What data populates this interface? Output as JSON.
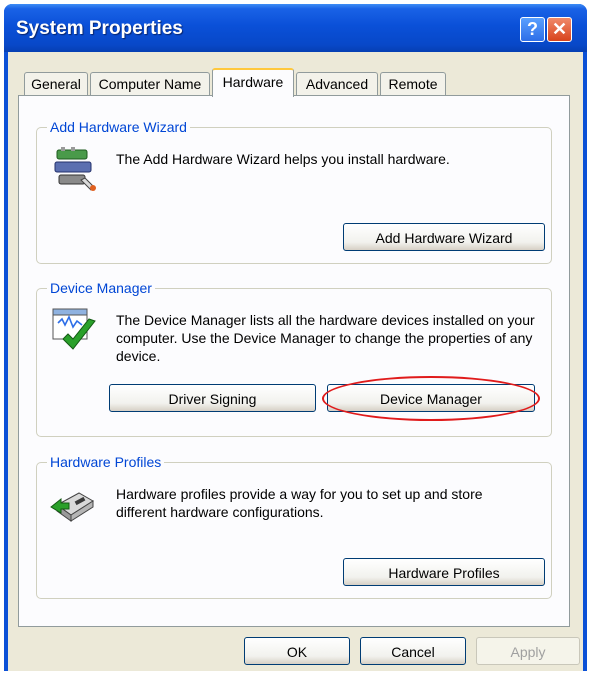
{
  "window": {
    "title": "System Properties",
    "help_glyph": "?",
    "close_glyph": "✕"
  },
  "tabs": [
    {
      "label": "General"
    },
    {
      "label": "Computer Name"
    },
    {
      "label": "Hardware",
      "active": true
    },
    {
      "label": "Advanced"
    },
    {
      "label": "Remote"
    }
  ],
  "add_hardware": {
    "group_title": "Add Hardware Wizard",
    "description": "The Add Hardware Wizard helps you install hardware.",
    "button_label": "Add Hardware Wizard",
    "icon": "add-hardware-wizard-icon"
  },
  "device_manager": {
    "group_title": "Device Manager",
    "description": "The Device Manager lists all the hardware devices installed on your computer. Use the Device Manager to change the properties of any device.",
    "driver_signing_label": "Driver Signing",
    "device_manager_label": "Device Manager",
    "icon": "device-manager-icon",
    "highlight_color": "#e01b1b"
  },
  "hardware_profiles": {
    "group_title": "Hardware Profiles",
    "description": "Hardware profiles provide a way for you to set up and store different hardware configurations.",
    "button_label": "Hardware Profiles",
    "icon": "hardware-profiles-icon"
  },
  "footer": {
    "ok_label": "OK",
    "cancel_label": "Cancel",
    "apply_label": "Apply",
    "apply_disabled": true
  },
  "colors": {
    "title_bar": "#0a50d8",
    "group_title": "#0046d5",
    "dialog_face": "#ece9d8"
  }
}
